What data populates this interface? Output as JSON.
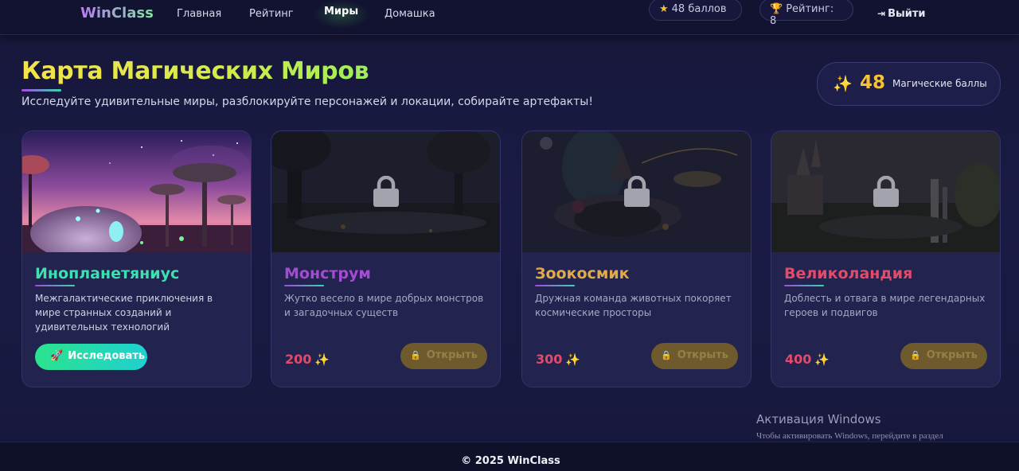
{
  "nav": {
    "logo": "WinClass",
    "links": [
      "Главная",
      "Рейтинг",
      "Миры",
      "Домашка"
    ],
    "points_pill": "48 баллов",
    "rating_pill": "Рейтинг: 8",
    "logout": "Выйти",
    "icons": {
      "points": "star-icon",
      "rating": "trophy-icon",
      "logout": "sign-out-icon"
    }
  },
  "hero": {
    "title": "Карта Магических Миров",
    "subtitle": "Исследуйте удивительные миры, разблокируйте персонажей и локации, собирайте артефакты!",
    "score_value": "48",
    "score_label": "Магические баллы"
  },
  "cards": [
    {
      "title": "Инопланетяниус",
      "desc": "Межгалактические приключения в мире странных созданий и удивительных технологий",
      "button": "Исследовать",
      "locked": false,
      "title_color": "#3de0b0"
    },
    {
      "title": "Монструм",
      "desc": "Жутко весело в мире добрых монстров и загадочных существ",
      "cost": "200",
      "button": "Открыть",
      "locked": true,
      "title_color": "#a64bd6"
    },
    {
      "title": "Зоокосмик",
      "desc": "Дружная команда животных покоряет космические просторы",
      "cost": "300",
      "button": "Открыть",
      "locked": true,
      "title_color": "#e0a94a"
    },
    {
      "title": "Великоландия",
      "desc": "Доблесть и отвага в мире легендарных героев и подвигов",
      "cost": "400",
      "button": "Открыть",
      "locked": true,
      "title_color": "#e24b6a"
    }
  ],
  "watermark": {
    "title": "Активация Windows",
    "subtitle": "Чтобы активировать Windows, перейдите в раздел \"Параметры\"."
  },
  "footer": {
    "text": "© 2025 WinClass"
  },
  "colors": {
    "accent_green": "#2be38d",
    "accent_gold": "#f6c232",
    "cost_red": "#e24b6a"
  }
}
